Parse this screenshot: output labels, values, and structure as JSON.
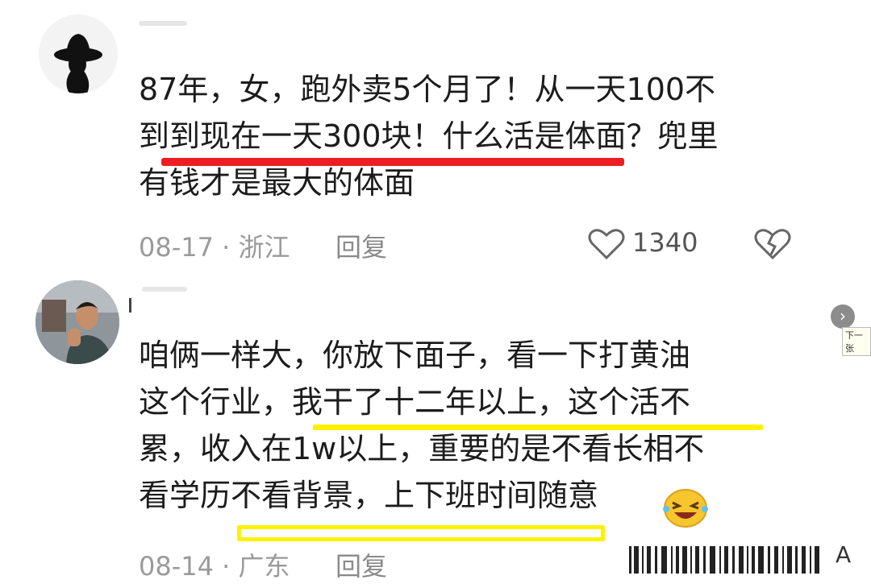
{
  "comments": [
    {
      "text_lines": [
        "87年，女，跑外卖5个月了！从一天100不",
        "到到现在一天300块！什么活是体面？兜里",
        "有钱才是最大的体面"
      ],
      "date_location": "08-17 · 浙江",
      "reply_label": "回复",
      "likes": "1340",
      "highlight_color": "#ee1c25"
    },
    {
      "text_lines": [
        "咱俩一样大，你放下面子，看一下打黄油",
        "这个行业，我干了十二年以上，这个活不",
        "累，收入在1w以上，重要的是不看长相不",
        "看学历不看背景，上下班时间随意"
      ],
      "date_location": "08-14 · 广东",
      "reply_label": "回复",
      "highlight_color": "#fff200"
    }
  ],
  "overlay": {
    "next_label": "下一张",
    "next_icon": "chevron-right-icon",
    "corner_text": "A"
  }
}
